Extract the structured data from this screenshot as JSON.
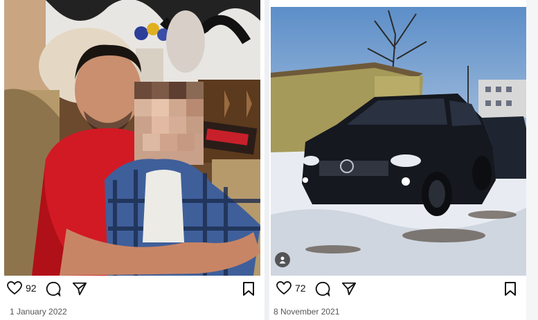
{
  "posts": [
    {
      "likes": "92",
      "date": "1 January 2022",
      "photo_subject": "man-with-child-photo"
    },
    {
      "likes": "72",
      "date": "8 November 2021",
      "photo_subject": "black-suv-snow-photo"
    }
  ],
  "icons": {
    "like": "heart-icon",
    "comment": "comment-bubble-icon",
    "share": "send-paper-plane-icon",
    "save": "bookmark-icon",
    "tag": "user-tag-icon"
  }
}
